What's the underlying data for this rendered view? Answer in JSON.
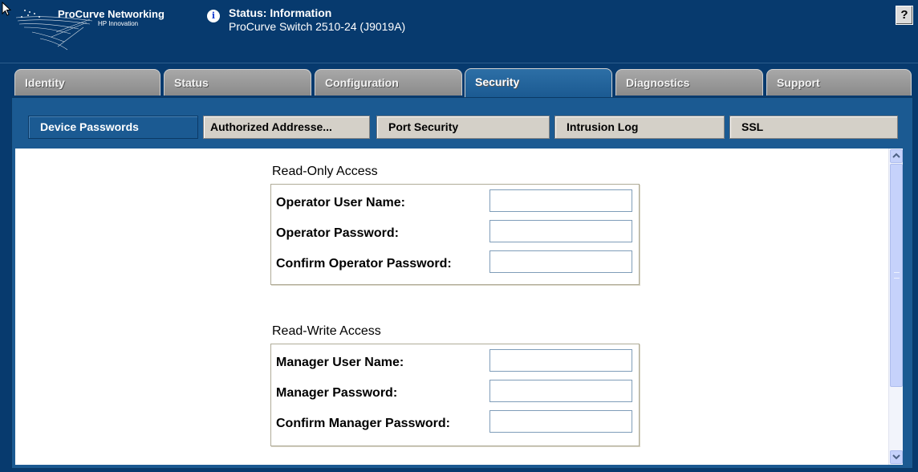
{
  "header": {
    "brand": "ProCurve Networking",
    "tagline": "HP Innovation",
    "status_title": "Status: Information",
    "device": "ProCurve Switch 2510-24 (J9019A)",
    "help_label": "?"
  },
  "tabs": [
    {
      "label": "Identity"
    },
    {
      "label": "Status"
    },
    {
      "label": "Configuration"
    },
    {
      "label": "Security",
      "active": true
    },
    {
      "label": "Diagnostics"
    },
    {
      "label": "Support"
    }
  ],
  "subtabs": [
    {
      "label": "Device Passwords",
      "active": true
    },
    {
      "label": "Authorized Addresse..."
    },
    {
      "label": "Port Security"
    },
    {
      "label": "Intrusion Log"
    },
    {
      "label": "SSL"
    }
  ],
  "sections": [
    {
      "title": "Read-Only Access",
      "fields": [
        {
          "label": "Operator User Name:",
          "value": ""
        },
        {
          "label": "Operator Password:",
          "value": ""
        },
        {
          "label": "Confirm Operator Password:",
          "value": ""
        }
      ]
    },
    {
      "title": "Read-Write Access",
      "fields": [
        {
          "label": "Manager User Name:",
          "value": ""
        },
        {
          "label": "Manager Password:",
          "value": ""
        },
        {
          "label": "Confirm Manager Password:",
          "value": ""
        }
      ]
    }
  ],
  "scrollbar": {
    "up_icon": "chevron-up-icon",
    "down_icon": "chevron-down-icon"
  },
  "colors": {
    "background": "#073a6e",
    "active_tab": "#1b5a92",
    "inactive_tab": "#999999"
  }
}
